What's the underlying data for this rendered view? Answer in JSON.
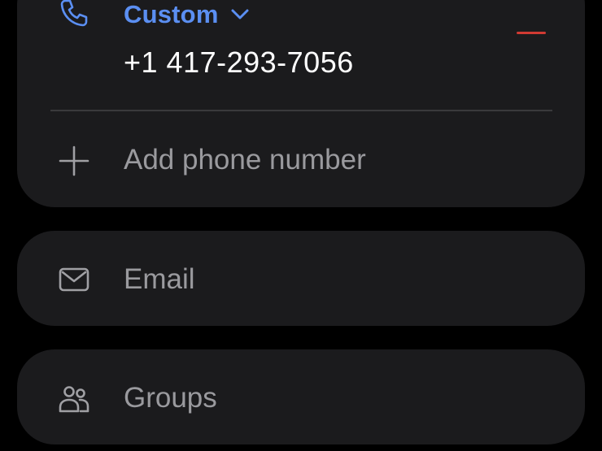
{
  "phone": {
    "type_label": "Custom",
    "number": "+1 417-293-7056",
    "add_label": "Add phone number"
  },
  "email": {
    "label": "Email"
  },
  "groups": {
    "label": "Groups"
  },
  "colors": {
    "accent": "#5b8ff2",
    "remove": "#d03a33",
    "card_bg": "#1b1b1d",
    "muted_text": "#9a9a9e"
  },
  "icons": {
    "phone": "phone-icon",
    "chevron": "chevron-down-icon",
    "remove": "minus-icon",
    "add": "plus-icon",
    "email": "mail-icon",
    "groups": "groups-icon"
  }
}
